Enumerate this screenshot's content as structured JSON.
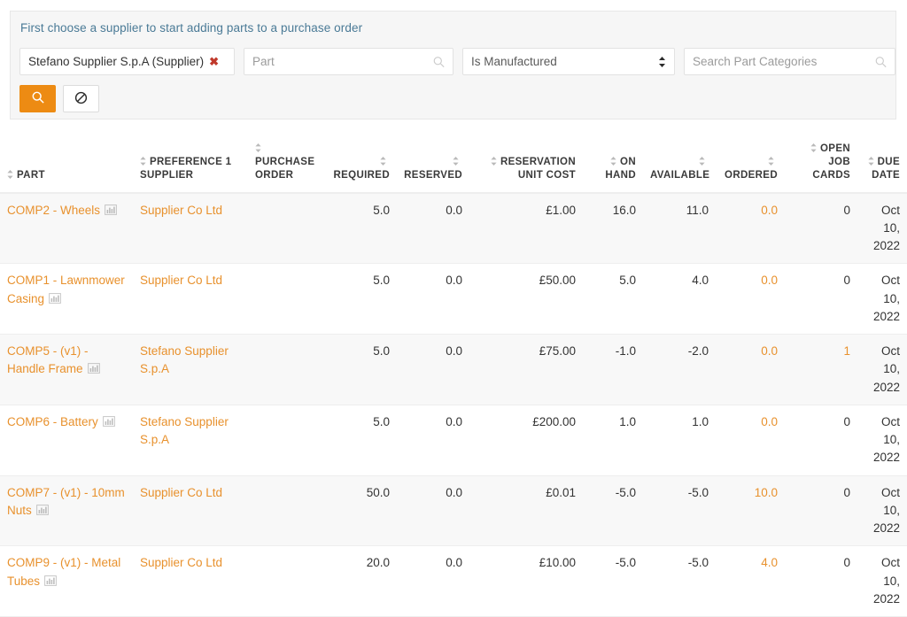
{
  "filter_panel": {
    "hint": "First choose a supplier to start adding parts to a purchase order",
    "supplier_chip": {
      "label": "Stefano Supplier S.p.A (Supplier)",
      "remove_label": "✖"
    },
    "part_input": {
      "value": "",
      "placeholder": "Part"
    },
    "manufactured_select": {
      "value": "Is Manufactured"
    },
    "categories_input": {
      "value": "",
      "placeholder": "Search Part Categories"
    },
    "search_button_label": "",
    "clear_button_label": ""
  },
  "table": {
    "columns": [
      {
        "key": "part",
        "label": "PART",
        "align": "left",
        "sortable": true
      },
      {
        "key": "sup",
        "label": "PREFERENCE 1 SUPPLIER",
        "align": "left",
        "sortable": true
      },
      {
        "key": "po",
        "label": "PURCHASE ORDER",
        "align": "left",
        "sortable": true
      },
      {
        "key": "req",
        "label": "REQUIRED",
        "align": "right",
        "sortable": true
      },
      {
        "key": "res",
        "label": "RESERVED",
        "align": "right",
        "sortable": true
      },
      {
        "key": "ruc",
        "label": "RESERVATION UNIT COST",
        "align": "right",
        "sortable": true
      },
      {
        "key": "onhand",
        "label": "ON HAND",
        "align": "right",
        "sortable": true
      },
      {
        "key": "avail",
        "label": "AVAILABLE",
        "align": "right",
        "sortable": true
      },
      {
        "key": "ordered",
        "label": "ORDERED",
        "align": "right",
        "sortable": true
      },
      {
        "key": "ojc",
        "label": "OPEN JOB CARDS",
        "align": "right",
        "sortable": true
      },
      {
        "key": "due",
        "label": "DUE DATE",
        "align": "right",
        "sortable": true
      }
    ],
    "rows": [
      {
        "part": "COMP2 - Wheels",
        "supplier": "Supplier Co Ltd",
        "purchase_order": "",
        "required": "5.0",
        "reserved": "0.0",
        "reservation_unit_cost": "£1.00",
        "on_hand": "16.0",
        "available": "11.0",
        "ordered": "0.0",
        "open_job_cards": "0",
        "due_date": "Oct 10, 2022"
      },
      {
        "part": "COMP1 - Lawnmower Casing",
        "supplier": "Supplier Co Ltd",
        "purchase_order": "",
        "required": "5.0",
        "reserved": "0.0",
        "reservation_unit_cost": "£50.00",
        "on_hand": "5.0",
        "available": "4.0",
        "ordered": "0.0",
        "open_job_cards": "0",
        "due_date": "Oct 10, 2022"
      },
      {
        "part": "COMP5 - (v1) - Handle Frame",
        "supplier": "Stefano Supplier S.p.A",
        "purchase_order": "",
        "required": "5.0",
        "reserved": "0.0",
        "reservation_unit_cost": "£75.00",
        "on_hand": "-1.0",
        "available": "-2.0",
        "ordered": "0.0",
        "open_job_cards": "1",
        "due_date": "Oct 10, 2022"
      },
      {
        "part": "COMP6 - Battery",
        "supplier": "Stefano Supplier S.p.A",
        "purchase_order": "",
        "required": "5.0",
        "reserved": "0.0",
        "reservation_unit_cost": "£200.00",
        "on_hand": "1.0",
        "available": "1.0",
        "ordered": "0.0",
        "open_job_cards": "0",
        "due_date": "Oct 10, 2022"
      },
      {
        "part": "COMP7 - (v1) - 10mm Nuts",
        "supplier": "Supplier Co Ltd",
        "purchase_order": "",
        "required": "50.0",
        "reserved": "0.0",
        "reservation_unit_cost": "£0.01",
        "on_hand": "-5.0",
        "available": "-5.0",
        "ordered": "10.0",
        "open_job_cards": "0",
        "due_date": "Oct 10, 2022"
      },
      {
        "part": "COMP9 - (v1) - Metal Tubes",
        "supplier": "Supplier Co Ltd",
        "purchase_order": "",
        "required": "20.0",
        "reserved": "0.0",
        "reservation_unit_cost": "£10.00",
        "on_hand": "-5.0",
        "available": "-5.0",
        "ordered": "4.0",
        "open_job_cards": "0",
        "due_date": "Oct 10, 2022"
      }
    ]
  },
  "colors": {
    "accent": "#e8912d",
    "primary_button": "#ed8b13",
    "hint_text": "#4a7a96",
    "chip_remove": "#c0392b",
    "stripe": "#f8f8f8"
  }
}
